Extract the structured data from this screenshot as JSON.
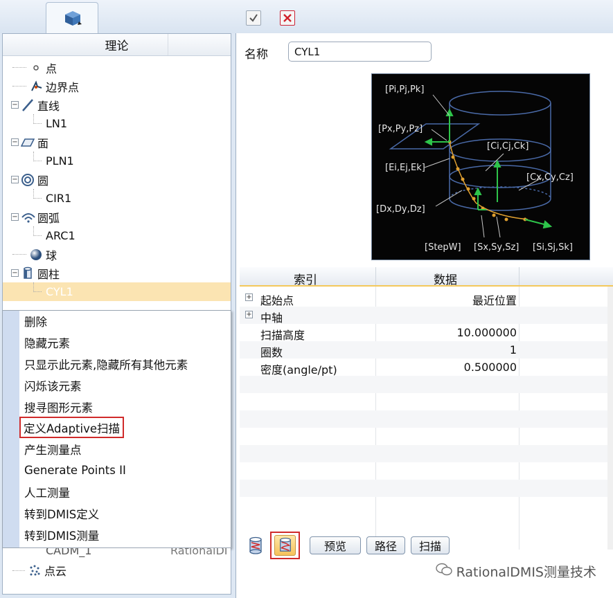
{
  "toolbar": {
    "left_tab_icon": "cube-icon",
    "check_icon": "checkbox-check-icon",
    "close_icon": "red-x-icon"
  },
  "tree": {
    "header": "理论",
    "items": [
      {
        "label": "点",
        "icon": "point-icon",
        "expander": ""
      },
      {
        "label": "边界点",
        "icon": "edge-point-icon",
        "expander": ""
      },
      {
        "label": "直线",
        "icon": "line-icon",
        "expander": "-"
      },
      {
        "label": "LN1",
        "icon": "",
        "expander": ""
      },
      {
        "label": "面",
        "icon": "plane-icon",
        "expander": "-"
      },
      {
        "label": "PLN1",
        "icon": "",
        "expander": ""
      },
      {
        "label": "圆",
        "icon": "circle-icon",
        "expander": "-"
      },
      {
        "label": "CIR1",
        "icon": "",
        "expander": ""
      },
      {
        "label": "圆弧",
        "icon": "arc-icon",
        "expander": "-"
      },
      {
        "label": "ARC1",
        "icon": "",
        "expander": ""
      },
      {
        "label": "球",
        "icon": "sphere-icon",
        "expander": ""
      },
      {
        "label": "圆柱",
        "icon": "cylinder-icon",
        "expander": "-"
      },
      {
        "label": "CYL1",
        "icon": "",
        "expander": ""
      }
    ],
    "bottom_items": [
      {
        "label": "CADM_1",
        "extra": "RationalDI"
      },
      {
        "label": "点云",
        "icon": "point-cloud-icon"
      }
    ]
  },
  "context_menu": {
    "items": [
      "删除",
      "隐藏元素",
      "只显示此元素,隐藏所有其他元素",
      "闪烁该元素",
      "搜寻图形元素",
      "定义Adaptive扫描",
      "产生测量点",
      "Generate Points II",
      "人工测量",
      "转到DMIS定义",
      "转到DMIS测量"
    ],
    "highlighted_index": 5
  },
  "properties": {
    "name_label": "名称",
    "name_value": "CYL1"
  },
  "diagram_labels": {
    "pi": "[Pi,Pj,Pk]",
    "px": "[Px,Py,Pz]",
    "ci": "[Ci,Cj,Ck]",
    "ei": "[Ei,Ej,Ek]",
    "cx": "[Cx,Cy,Cz]",
    "dx": "[Dx,Dy,Dz]",
    "stepw": "[StepW]",
    "sx": "[Sx,Sy,Sz]",
    "si": "[Si,Sj,Sk]"
  },
  "grid": {
    "col_index": "索引",
    "col_data": "数据",
    "rows": [
      {
        "key": "起始点",
        "value": "最近位置",
        "expander": "+"
      },
      {
        "key": "中轴",
        "value": "",
        "expander": "+"
      },
      {
        "key": "扫描高度",
        "value": "10.000000",
        "expander": ""
      },
      {
        "key": "圈数",
        "value": "1",
        "expander": ""
      },
      {
        "key": "密度(angle/pt)",
        "value": "0.500000",
        "expander": ""
      }
    ]
  },
  "buttons": {
    "cyl_icon_1": "cylinder-db-icon",
    "cyl_icon_2": "cylinder-scan-icon",
    "preview": "预览",
    "path": "路径",
    "scan": "扫描"
  },
  "watermark": "RationalDMIS测量技术",
  "colors": {
    "selection": "#fbe4b2",
    "highlight_border": "#d02a2a",
    "diagram_bg": "#050505",
    "diagram_green": "#2ec44a",
    "diagram_orange": "#e0a030"
  }
}
